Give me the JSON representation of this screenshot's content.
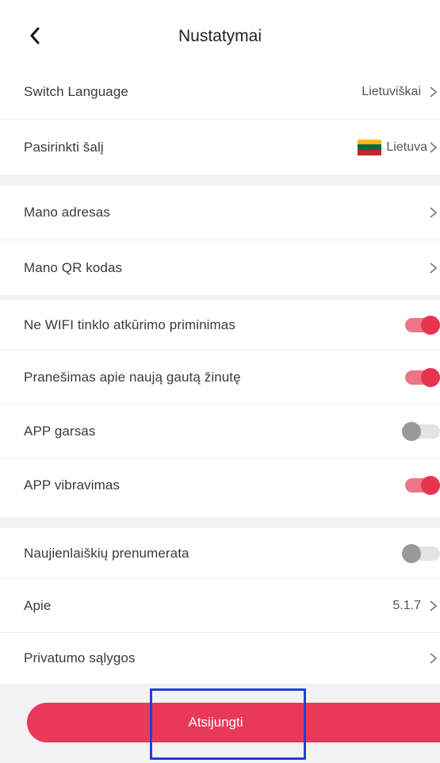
{
  "header": {
    "title": "Nustatymai"
  },
  "section_general": {
    "rows": [
      {
        "label": "Switch Language",
        "value": "Lietuviškai"
      },
      {
        "label": "Pasirinkti šalį",
        "value": "Lietuva",
        "flag": [
          "#fdb913",
          "#006a44",
          "#c1272d"
        ]
      }
    ]
  },
  "section_account": {
    "rows": [
      {
        "label": "Mano adresas"
      },
      {
        "label": "Mano QR kodas"
      }
    ]
  },
  "section_notifications": {
    "rows": [
      {
        "label": "Ne WIFI tinklo atkūrimo priminimas",
        "enabled": true
      },
      {
        "label": "Pranešimas apie naują gautą žinutę",
        "enabled": true
      },
      {
        "label": "APP garsas",
        "enabled": false
      },
      {
        "label": "APP vibravimas",
        "enabled": true
      }
    ]
  },
  "section_about": {
    "rows": [
      {
        "label": "Naujienlaiškių prenumerata",
        "enabled": false
      },
      {
        "label": "Apie",
        "value": "5.1.7"
      },
      {
        "label": "Privatumo sąlygos"
      }
    ]
  },
  "logout": {
    "label": "Atsijungti"
  },
  "colors": {
    "accent": "#e8395a",
    "toggle_on_knob": "#e8354f",
    "toggle_on_track": "#ee7587",
    "toggle_off_knob": "#999999",
    "toggle_off_track": "#e4e4e4",
    "highlight": "#1d3fe0"
  },
  "icons": {
    "back": "chevron-left-icon",
    "row_arrow": "chevron-right-icon"
  }
}
